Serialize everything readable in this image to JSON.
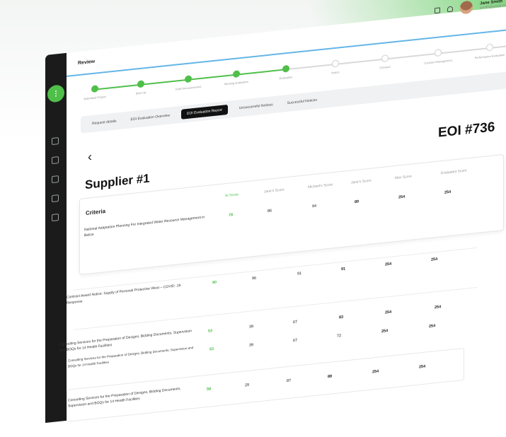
{
  "header": {
    "page_title": "Review",
    "user_name": "Jane Smith",
    "user_email": "jsmith@gmail.com"
  },
  "stepper": {
    "steps": [
      {
        "label": "Submitted Project",
        "done": true
      },
      {
        "label": "Start Up",
        "done": true
      },
      {
        "label": "Draft Announcement",
        "done": true
      },
      {
        "label": "Meeting Evaluation",
        "done": true
      },
      {
        "label": "Evaluation",
        "done": true
      },
      {
        "label": "Notice",
        "done": false
      },
      {
        "label": "Contract",
        "done": false
      },
      {
        "label": "Contract Management",
        "done": false
      },
      {
        "label": "Performance Evaluation",
        "done": false
      }
    ]
  },
  "tabs": {
    "items": [
      "Request details",
      "EOI Evaluation Overview",
      "EOI Evaluation Report",
      "Unsuccessful Notices",
      "Successful Notices"
    ],
    "active_index": 2
  },
  "main": {
    "back_glyph": "‹",
    "supplier_title": "Supplier #1",
    "eoi_title": "EOI #736"
  },
  "table": {
    "headers": [
      "Criteria",
      "AI Score",
      "Jane's Score",
      "Michael's Score",
      "Jane's Score",
      "Max Score",
      "Evaluated Score"
    ],
    "rows": [
      {
        "criteria": "National Adaptation Planning For Integrated Water Resource Management in Belize",
        "ai": "78",
        "s1": "86",
        "s2": "94",
        "s3": "89",
        "max": "254",
        "evaluated": "254"
      },
      {
        "criteria": "Contract Award Notice: Supply of Personal Protective Wear – COVID -19 Response",
        "ai": "90",
        "s1": "96",
        "s2": "91",
        "s3": "91",
        "max": "254",
        "evaluated": "254"
      },
      {
        "criteria": "Consulting Services for the Preparation of Designs, Bidding Documents, Supervision and BOQs for 14 Health Facilities",
        "ai": "53",
        "s1": "39",
        "s2": "67",
        "s3": "83",
        "max": "254",
        "evaluated": "254"
      },
      {
        "criteria": "Consulting Services for the Preparation of Designs, Bidding Documents, Supervision and BOQs for 14 Health Facilities",
        "ai": "53",
        "s1": "39",
        "s2": "67",
        "s3": "72",
        "max": "254",
        "evaluated": "254"
      },
      {
        "criteria": "Consulting Services for the Preparation of Designs, Bidding Documents, Supervision and BOQs for 14 Health Facilities",
        "ai": "58",
        "s1": "29",
        "s2": "87",
        "s3": "88",
        "max": "254",
        "evaluated": "254"
      }
    ]
  },
  "colors": {
    "accent_green": "#4fbf4a",
    "topbar_line": "#64b5e8",
    "sidebar": "#1b1b1b"
  }
}
